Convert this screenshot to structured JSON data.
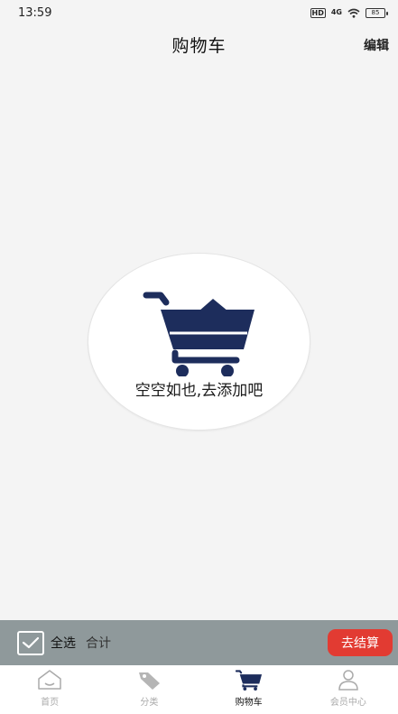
{
  "status_bar": {
    "time": "13:59",
    "hd": "HD",
    "network": "4G",
    "battery": "85"
  },
  "header": {
    "title": "购物车",
    "edit_label": "编辑"
  },
  "empty_state": {
    "message": "空空如也,去添加吧",
    "icon": "shopping-cart-icon"
  },
  "checkout_bar": {
    "select_all_label": "全选",
    "total_label": "合计",
    "checkout_label": "去结算"
  },
  "bottom_nav": {
    "items": [
      {
        "label": "首页",
        "icon": "home-icon",
        "active": false
      },
      {
        "label": "分类",
        "icon": "tag-icon",
        "active": false
      },
      {
        "label": "购物车",
        "icon": "cart-icon",
        "active": true
      },
      {
        "label": "会员中心",
        "icon": "user-icon",
        "active": false
      }
    ]
  },
  "colors": {
    "accent": "#e23b32",
    "cart_navy": "#1d2d5c",
    "checkout_bar_bg": "#8f999b",
    "page_bg": "#f4f4f4"
  }
}
